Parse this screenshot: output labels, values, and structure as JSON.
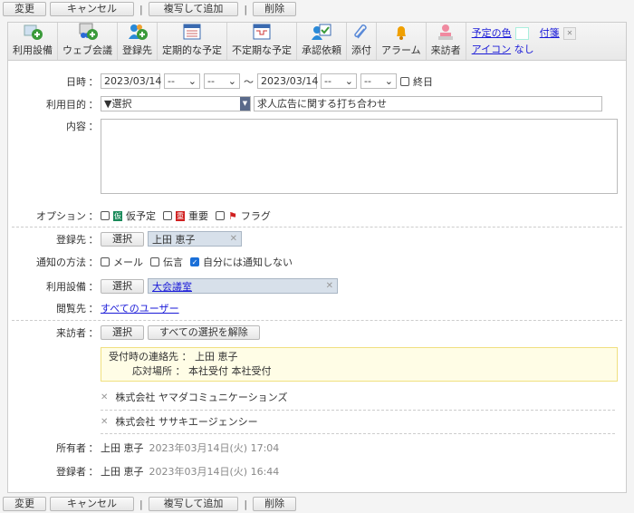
{
  "actions": {
    "change": "変更",
    "cancel": "キャンセル",
    "copy_add": "複写して追加",
    "delete": "削除",
    "sep": "|"
  },
  "toolbar": [
    {
      "label": "利用設備",
      "icon": "facility-add-icon"
    },
    {
      "label": "ウェブ会議",
      "icon": "web-meeting-add-icon"
    },
    {
      "label": "登録先",
      "icon": "user-add-icon"
    },
    {
      "label": "定期的な予定",
      "icon": "calendar-recurring-icon"
    },
    {
      "label": "不定期な予定",
      "icon": "calendar-irregular-icon"
    },
    {
      "label": "承認依頼",
      "icon": "approval-icon"
    },
    {
      "label": "添付",
      "icon": "paperclip-icon"
    },
    {
      "label": "アラーム",
      "icon": "bell-icon"
    },
    {
      "label": "来訪者",
      "icon": "visitor-icon"
    }
  ],
  "extras": {
    "color_label": "予定の色",
    "sticky_label": "付箋",
    "icon_label": "アイコン",
    "icon_value": "なし",
    "close": "✕"
  },
  "form": {
    "datetime_label": "日時",
    "start_date": "2023/03/14",
    "start_hour": "--",
    "start_min": "--",
    "tilde": "〜",
    "end_date": "2023/03/14",
    "end_hour": "--",
    "end_min": "--",
    "allday": "終日",
    "purpose_label": "利用目的",
    "purpose_select": "▼選択",
    "purpose_text": "求人広告に関する打ち合わせ",
    "content_label": "内容",
    "option_label": "オプション",
    "opt_tentative": "仮予定",
    "opt_important": "重要",
    "opt_flag": "フラグ",
    "badge_tentative": "仮",
    "badge_important": "重",
    "registrant_label": "登録先",
    "select_btn": "選択",
    "registrant": "上田 恵子",
    "notify_label": "通知の方法",
    "notify_mail": "メール",
    "notify_message": "伝言",
    "notify_self": "自分には通知しない",
    "facility_label": "利用設備",
    "facility": "大会議室",
    "viewer_label": "閲覧先",
    "viewer": "すべてのユーザー",
    "visitor_label": "来訪者",
    "clear_all": "すべての選択を解除",
    "contact_label": "受付時の連絡先",
    "contact": "上田 恵子",
    "place_label": "応対場所",
    "place": "本社受付 本社受付",
    "visitors": [
      "株式会社 ヤマダコミュニケーションズ",
      "株式会社 ササキエージェンシー"
    ],
    "owner_label": "所有者",
    "owner": "上田 恵子",
    "owner_time": "2023年03月14日(火) 17:04",
    "creator_label": "登録者",
    "creator": "上田 恵子",
    "creator_time": "2023年03月14日(火) 16:44",
    "colon": "："
  }
}
